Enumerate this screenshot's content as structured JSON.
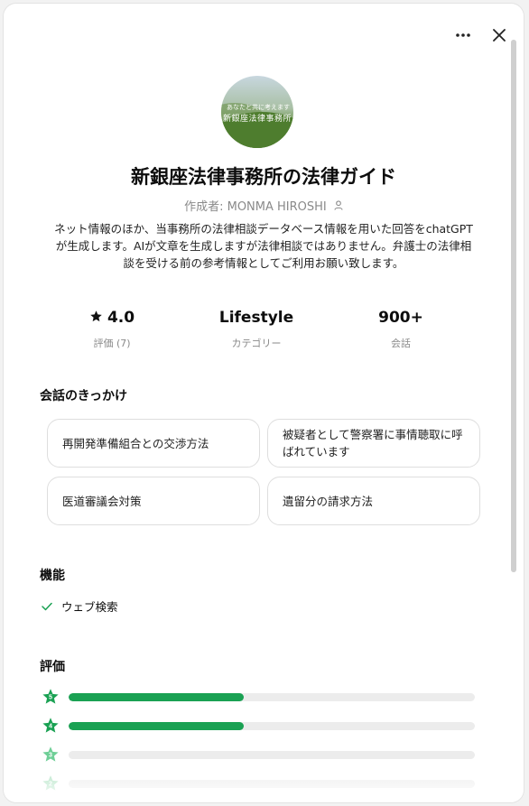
{
  "header": {
    "more_icon": "more-horizontal-icon",
    "close_icon": "close-icon"
  },
  "gpt": {
    "avatar_caption_small": "あなたと共に考えます",
    "avatar_caption_big": "新銀座法律事務所",
    "title": "新銀座法律事務所の法律ガイド",
    "author": "作成者: MONMA HIROSHI",
    "description": "ネット情報のほか、当事務所の法律相談データベース情報を用いた回答をchatGPTが生成します。AIが文章を生成しますが法律相談ではありません。弁護士の法律相談を受ける前の参考情報としてご利用お願い致します。"
  },
  "stats": {
    "rating_value": "4.0",
    "rating_label": "評価 (7)",
    "category_value": "Lifestyle",
    "category_label": "カテゴリー",
    "conversations_value": "900+",
    "conversations_label": "会話"
  },
  "starters": {
    "title": "会話のきっかけ",
    "items": [
      "再開発準備組合との交渉方法",
      "被疑者として警察署に事情聴取に呼ばれています",
      "医道審議会対策",
      "遺留分の請求方法"
    ]
  },
  "capabilities": {
    "title": "機能",
    "items": [
      "ウェブ検索"
    ]
  },
  "ratings": {
    "title": "評価",
    "rows": [
      {
        "stars": "5",
        "fraction": 0.43,
        "color": "#1aa153"
      },
      {
        "stars": "4",
        "fraction": 0.43,
        "color": "#1aa153"
      },
      {
        "stars": "3",
        "fraction": 0,
        "color": "#6fcf97"
      },
      {
        "stars": "2",
        "fraction": 0,
        "color": "#a8e0bd"
      }
    ]
  },
  "colors": {
    "accent": "#1aa153",
    "muted": "#8a8a8a"
  }
}
